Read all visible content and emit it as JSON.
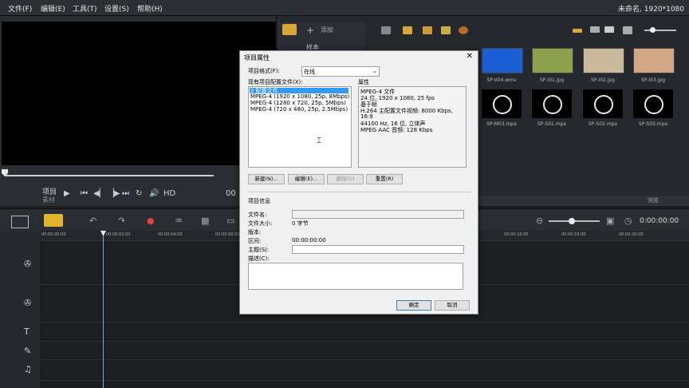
{
  "menubar": {
    "items": [
      "文件(F)",
      "编辑(E)",
      "工具(T)",
      "设置(S)",
      "帮助(H)"
    ],
    "project_title": "未命名, 1920*1080"
  },
  "preview": {
    "label_project": "项目",
    "label_clip": "素材",
    "hd_label": "HD",
    "timecode": "00"
  },
  "library": {
    "add_label": "添加",
    "sample_label": "样本",
    "bottom_label": "浏览",
    "thumbnails": [
      {
        "label": "SP-V04.wmv",
        "color": "#1a5fd6"
      },
      {
        "label": "SP-I01.jpg",
        "color": "#8aa04a"
      },
      {
        "label": "SP-I02.jpg",
        "color": "#c9b89a"
      },
      {
        "label": "SP-I03.jpg",
        "color": "#d2a884"
      }
    ],
    "audio_items": [
      {
        "label": "SP-M03.mpa"
      },
      {
        "label": "SP-S01.mpa"
      },
      {
        "label": "SP-S02.mpa"
      },
      {
        "label": "SP-S03.mpa"
      }
    ]
  },
  "timeline": {
    "timecode": "0:00:00:00",
    "ruler": [
      "00:00:00:00",
      "00:00:02:00",
      "00:00:04:00",
      "00:00:06:00",
      "00:00:16:00",
      "00:00:18:00",
      "00:00:20:00"
    ]
  },
  "dialog": {
    "title": "项目属性",
    "format_label": "项目格式(F):",
    "format_value": "在线",
    "profiles_label": "现有项目配置文件(X):",
    "profiles": [
      "2 配置文件",
      "MPEG-4 (1920 x 1080, 25p, 8Mbps)",
      "MPEG-4 (1280 x 720, 25p, 5Mbps)",
      "MPEG-4 (720 x 480, 25p, 2.5Mbps)"
    ],
    "properties_label": "属性",
    "properties_lines": [
      "MPEG-4 文件",
      "24 位, 1920 x 1080, 25 fps",
      "基于帧",
      "H.264 主配置文件视频: 8000 Kbps,",
      "16:9",
      "44100 Hz, 16 位, 立体声",
      "MPEG AAC 音频: 128 Kbps"
    ],
    "buttons": {
      "new": "新建(N)...",
      "edit": "编辑(E)...",
      "delete": "删除(D)",
      "reset": "重置(R)",
      "ok": "确定",
      "cancel": "取消"
    },
    "info_label": "项目信息",
    "filename_label": "文件名:",
    "filesize_label": "文件大小:",
    "filesize_value": "0 字节",
    "version_label": "版本:",
    "duration_label": "区间:",
    "duration_value": "00:00:00:00",
    "subject_label": "主题(S):",
    "description_label": "描述(C):"
  }
}
